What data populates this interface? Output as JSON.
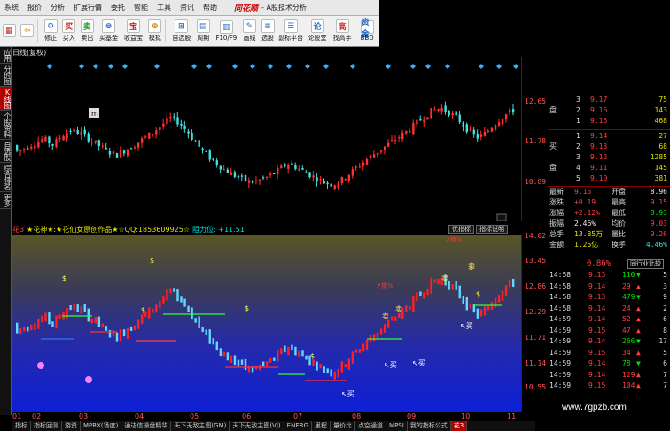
{
  "menu": {
    "items": [
      "系统",
      "报价",
      "分析",
      "扩展行情",
      "委托",
      "智能",
      "工具",
      "资讯",
      "帮助"
    ],
    "brand": "同花顺",
    "title": "- A股技术分析"
  },
  "toolbar": {
    "buttons": [
      {
        "label": "",
        "icon": "color-grid-icon",
        "color": "#c03030",
        "glyph": "▦"
      },
      {
        "label": "",
        "icon": "back-arrow-icon",
        "color": "#e8a000",
        "glyph": "⇦"
      },
      {
        "label": "修正",
        "icon": "gear-icon",
        "color": "#3a6fc0",
        "glyph": "⚙"
      },
      {
        "label": "买入",
        "icon": "buy-icon",
        "color": "#d02020",
        "glyph": "买"
      },
      {
        "label": "卖出",
        "icon": "sell-icon",
        "color": "#20a020",
        "glyph": "卖"
      },
      {
        "label": "买基金",
        "icon": "fund-icon",
        "color": "#2060c0",
        "glyph": "⊜"
      },
      {
        "label": "收益宝",
        "icon": "treasure-icon",
        "color": "#d02020",
        "glyph": "宝"
      },
      {
        "label": "模拟",
        "icon": "simulate-icon",
        "color": "#e08000",
        "glyph": "⊕"
      },
      {
        "label": "自选股",
        "icon": "watchlist-icon",
        "color": "#3070c0",
        "glyph": "⊞"
      },
      {
        "label": "周期",
        "icon": "period-icon",
        "color": "#3070c0",
        "glyph": "▤"
      },
      {
        "label": "F10/F9",
        "icon": "f10-icon",
        "color": "#3070c0",
        "glyph": "▥"
      },
      {
        "label": "画线",
        "icon": "draw-line-icon",
        "color": "#3070c0",
        "glyph": "✎"
      },
      {
        "label": "选股",
        "icon": "stock-picker-icon",
        "color": "#3070c0",
        "glyph": "≡"
      },
      {
        "label": "副标平台",
        "icon": "platform-icon",
        "color": "#3070c0",
        "glyph": "☰"
      },
      {
        "label": "论股堂",
        "icon": "forum-icon",
        "color": "#3070c0",
        "glyph": "论"
      },
      {
        "label": "找高手",
        "icon": "expert-icon",
        "color": "#d02020",
        "glyph": "高"
      },
      {
        "label": "BBD",
        "icon": "bbd-icon",
        "color": "#2060c0",
        "glyph": "资金"
      }
    ]
  },
  "left_tabs": [
    {
      "label": "应用",
      "active": false
    },
    {
      "label": "分时图",
      "active": false
    },
    {
      "label": "K线图",
      "active": true
    },
    {
      "label": "个股资料",
      "active": false
    },
    {
      "label": "自选股",
      "active": false
    },
    {
      "label": "综合排名",
      "active": false
    },
    {
      "label": "更多",
      "active": false
    }
  ],
  "chart": {
    "title": "日线(复权)",
    "price_axis": [
      "12.65",
      "11.78",
      "10.89"
    ],
    "cursor_label": "m"
  },
  "indicator": {
    "name": "花3",
    "desc": "★花神★:★花仙女原创作品★☆QQ:1853609925☆",
    "resistance": "阻力位: +11.51",
    "buttons": [
      "优指标",
      "指标说明"
    ],
    "axis": [
      "14.02",
      "13.45",
      "12.86",
      "12.29",
      "11.71",
      "11.14",
      "10.55"
    ],
    "annotations": {
      "buy": "买",
      "sell": "卖",
      "dollar": "$",
      "up_trend": "↗撑%"
    }
  },
  "chart_data": {
    "type": "table",
    "dates": [
      "01",
      "02",
      "03",
      "04",
      "05",
      "06",
      "07",
      "08",
      "09",
      "10",
      "11"
    ]
  },
  "bottom_tabs": [
    {
      "label": "指标",
      "active": false
    },
    {
      "label": "指标回测",
      "active": false
    },
    {
      "label": "游资",
      "active": false
    },
    {
      "label": "MPRX(场度)",
      "active": false
    },
    {
      "label": "通达信操盘精华",
      "active": false
    },
    {
      "label": "天下无敌主图(GM)",
      "active": false
    },
    {
      "label": "天下无敌主图(VJ)",
      "active": false
    },
    {
      "label": "ENERG",
      "active": false
    },
    {
      "label": "里程",
      "active": false
    },
    {
      "label": "量价比",
      "active": false
    },
    {
      "label": "点空通道",
      "active": false
    },
    {
      "label": "MPSI",
      "active": false
    },
    {
      "label": "我的指标公式",
      "active": false
    },
    {
      "label": "花3",
      "active": true
    }
  ],
  "quote": {
    "asks": [
      {
        "side": "",
        "level": "3",
        "price": "9.17",
        "vol": "75"
      },
      {
        "side": "盘",
        "level": "2",
        "price": "9.16",
        "vol": "143"
      },
      {
        "side": "",
        "level": "1",
        "price": "9.15",
        "vol": "468"
      }
    ],
    "bids": [
      {
        "side": "",
        "level": "1",
        "price": "9.14",
        "vol": "27"
      },
      {
        "side": "买",
        "level": "2",
        "price": "9.13",
        "vol": "68"
      },
      {
        "side": "",
        "level": "3",
        "price": "9.12",
        "vol": "1285"
      },
      {
        "side": "盘",
        "level": "4",
        "price": "9.11",
        "vol": "145"
      },
      {
        "side": "",
        "level": "5",
        "price": "9.10",
        "vol": "381"
      }
    ],
    "stats": [
      {
        "l1": "最新",
        "v1": "9.15",
        "c1": "red",
        "l2": "开盘",
        "v2": "8.96",
        "c2": "white"
      },
      {
        "l1": "涨跌",
        "v1": "+0.19",
        "c1": "red",
        "l2": "最高",
        "v2": "9.15",
        "c2": "red"
      },
      {
        "l1": "涨幅",
        "v1": "+2.12%",
        "c1": "red",
        "l2": "最低",
        "v2": "8.93",
        "c2": "green"
      },
      {
        "l1": "振幅",
        "v1": "2.46%",
        "c1": "white",
        "l2": "均价",
        "v2": "9.03",
        "c2": "red"
      },
      {
        "l1": "总手",
        "v1": "13.85万",
        "c1": "yellow",
        "l2": "量比",
        "v2": "9.26",
        "c2": "red"
      },
      {
        "l1": "金额",
        "v1": "1.25亿",
        "c1": "yellow",
        "l2": "换手",
        "v2": "4.46%",
        "c2": "cyan"
      }
    ],
    "compare_pct": "0.86%",
    "compare_btn": "同行业比较"
  },
  "ticks": [
    {
      "time": "14:58",
      "price": "9.13",
      "vol": "110",
      "dir": "down",
      "num": "5"
    },
    {
      "time": "14:58",
      "price": "9.14",
      "vol": "29",
      "dir": "up",
      "num": "3"
    },
    {
      "time": "14:58",
      "price": "9.13",
      "vol": "479",
      "dir": "down",
      "num": "9"
    },
    {
      "time": "14:58",
      "price": "9.14",
      "vol": "24",
      "dir": "up",
      "num": "2"
    },
    {
      "time": "14:59",
      "price": "9.14",
      "vol": "52",
      "dir": "up",
      "num": "6"
    },
    {
      "time": "14:59",
      "price": "9.15",
      "vol": "47",
      "dir": "up",
      "num": "8"
    },
    {
      "time": "14:59",
      "price": "9.14",
      "vol": "266",
      "dir": "down",
      "num": "17"
    },
    {
      "time": "14:59",
      "price": "9.15",
      "vol": "34",
      "dir": "up",
      "num": "5"
    },
    {
      "time": "14:59",
      "price": "9.14",
      "vol": "78",
      "dir": "down",
      "num": "6"
    },
    {
      "time": "14:59",
      "price": "9.14",
      "vol": "129",
      "dir": "up",
      "num": "7"
    },
    {
      "time": "14:59",
      "price": "9.15",
      "vol": "104",
      "dir": "up",
      "num": "7"
    }
  ],
  "watermark": "www.7gpzb.com",
  "colors": {
    "up": "#ff3030",
    "down": "#40e0e0",
    "axis": "#8b0000",
    "indicator_bg_top": "#595525",
    "indicator_bg_bottom": "#0e1fd6"
  }
}
